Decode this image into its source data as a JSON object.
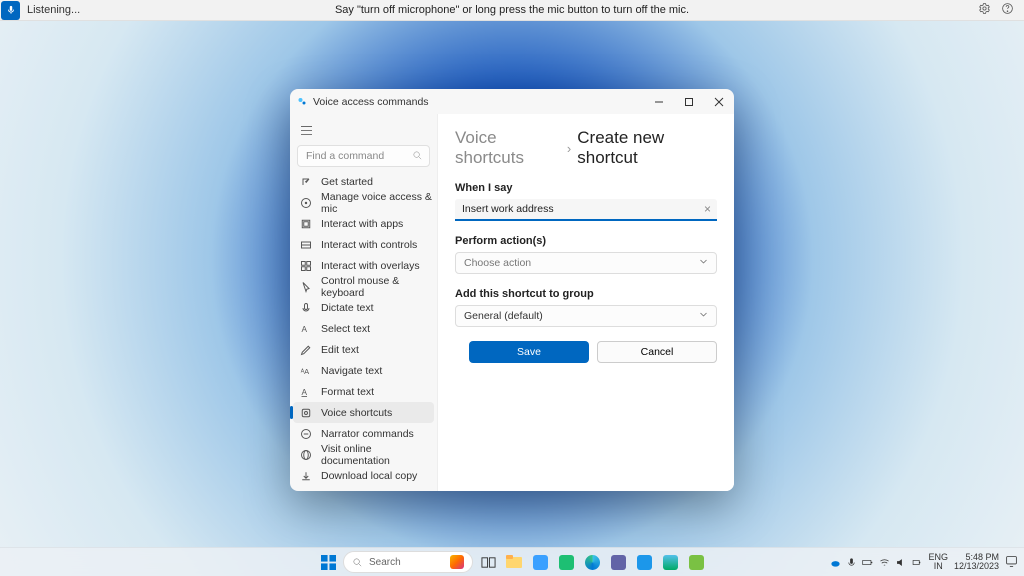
{
  "voice_bar": {
    "status": "Listening...",
    "hint": "Say \"turn off microphone\" or long press the mic button to turn off the mic."
  },
  "window": {
    "title": "Voice access commands",
    "search_placeholder": "Find a command",
    "sidebar": [
      {
        "label": "Get started"
      },
      {
        "label": "Manage voice access & mic"
      },
      {
        "label": "Interact with apps"
      },
      {
        "label": "Interact with controls"
      },
      {
        "label": "Interact with overlays"
      },
      {
        "label": "Control mouse & keyboard"
      },
      {
        "label": "Dictate text"
      },
      {
        "label": "Select text"
      },
      {
        "label": "Edit text"
      },
      {
        "label": "Navigate text"
      },
      {
        "label": "Format text"
      },
      {
        "label": "Voice shortcuts"
      },
      {
        "label": "Narrator commands"
      },
      {
        "label": "Visit online documentation"
      },
      {
        "label": "Download local copy"
      }
    ],
    "selected_index": 11
  },
  "content": {
    "crumb_parent": "Voice shortcuts",
    "crumb_current": "Create new shortcut",
    "when_label": "When I say",
    "when_value": "Insert work address",
    "perform_label": "Perform action(s)",
    "perform_value": "Choose action",
    "group_label": "Add this shortcut to group",
    "group_value": "General (default)",
    "save": "Save",
    "cancel": "Cancel"
  },
  "taskbar": {
    "search_placeholder": "Search",
    "lang1": "ENG",
    "lang2": "IN",
    "time": "5:48 PM",
    "date": "12/13/2023"
  }
}
